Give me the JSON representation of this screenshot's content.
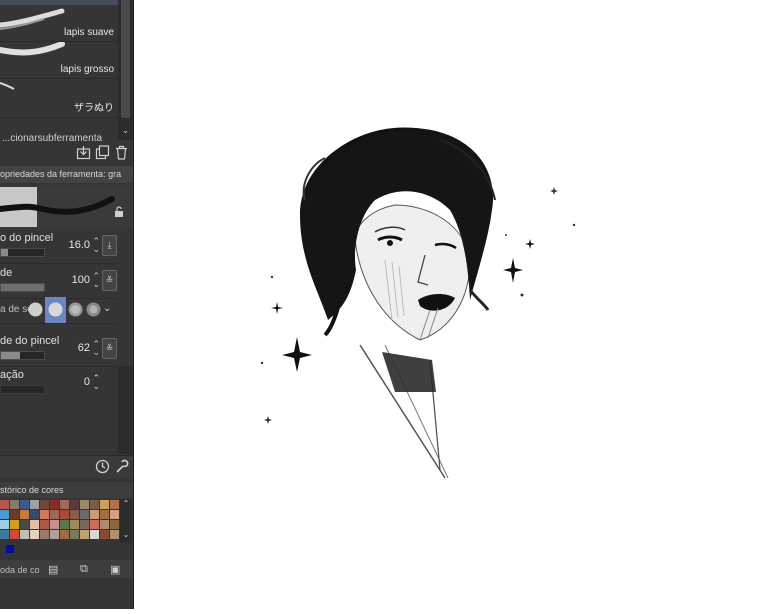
{
  "brushes": {
    "items": [
      {
        "label": "lapis suave"
      },
      {
        "label": "lapis grosso"
      },
      {
        "label": "ザラぬり"
      }
    ],
    "next_partial_label": "...cionarsubferramenta"
  },
  "tool_properties": {
    "header": "opriedades da ferramenta: gra",
    "properties": [
      {
        "name": "o do pincel",
        "value": "16.0",
        "fill": 0.16
      },
      {
        "name": "de",
        "value": "100",
        "fill": 1.0
      },
      {
        "name": "de do pincel",
        "value": "62",
        "fill": 0.45
      },
      {
        "name": "ação",
        "value": "0",
        "fill": 0.0
      }
    ],
    "tip_shape_label": "a de se"
  },
  "color_history": {
    "header": "stórico de cores",
    "colors": [
      "#b55a4a",
      "#8a7a6a",
      "#3c5a8a",
      "#a0a0a0",
      "#6a4a3a",
      "#8a2a2a",
      "#a06a5a",
      "#5a3a3a",
      "#9a8a6a",
      "#7a5a4a",
      "#c8a060",
      "#b07050",
      "#4a9ad0",
      "#6a3a2a",
      "#c87a3a",
      "#3a4a6a",
      "#d07a5a",
      "#9a6a5a",
      "#aa4a3a",
      "#8a5a4a",
      "#6a6a6a",
      "#c89a7a",
      "#a07040",
      "#d0a080",
      "#9ad0e0",
      "#d0a020",
      "#4a4a4a",
      "#e0c0a0",
      "#aa5a4a",
      "#c89090",
      "#5a7a4a",
      "#a08a5a",
      "#7a6a5a",
      "#d06a5a",
      "#b08a6a",
      "#8a6a3a",
      "#3a7a9a",
      "#d04a3a",
      "#c0c0b0",
      "#e8d0c0",
      "#9a7a6a",
      "#b0a0a0",
      "#a06a4a",
      "#7a7a5a",
      "#c0a070",
      "#d8d8d8",
      "#8a4a3a",
      "#b09070"
    ],
    "current_color": "#0a0aaa"
  },
  "footer": {
    "tab_label": "oda de co"
  }
}
